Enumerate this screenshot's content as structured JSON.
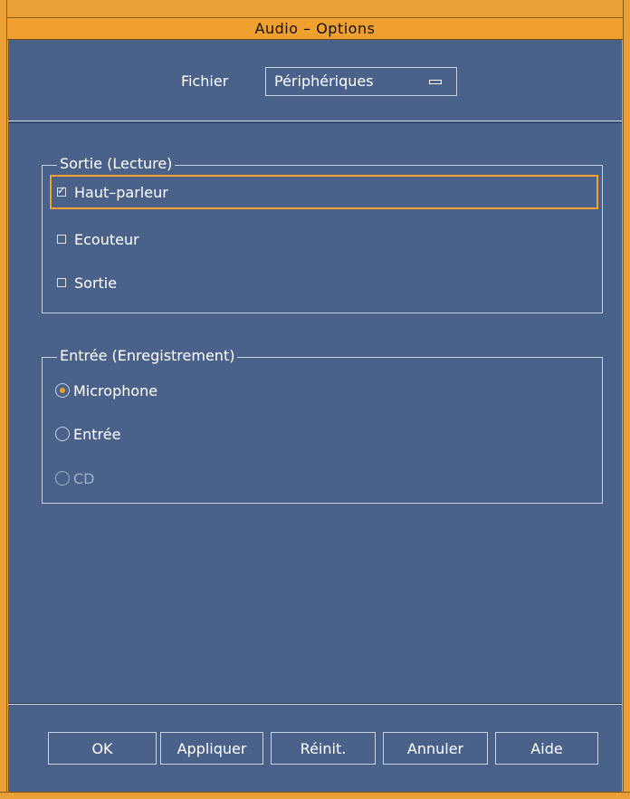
{
  "window": {
    "title": "Audio – Options"
  },
  "header": {
    "fichier_label": "Fichier",
    "category_value": "Périphériques"
  },
  "output_group": {
    "legend": "Sortie (Lecture)",
    "items": [
      {
        "label": "Haut–parleur",
        "checked": true
      },
      {
        "label": "Ecouteur",
        "checked": false
      },
      {
        "label": "Sortie",
        "checked": false
      }
    ]
  },
  "input_group": {
    "legend": "Entrée (Enregistrement)",
    "items": [
      {
        "label": "Microphone",
        "selected": true,
        "enabled": true
      },
      {
        "label": "Entrée",
        "selected": false,
        "enabled": true
      },
      {
        "label": "CD",
        "selected": false,
        "enabled": false
      }
    ]
  },
  "buttons": {
    "ok": "OK",
    "apply": "Appliquer",
    "reset": "Réinit.",
    "cancel": "Annuler",
    "help": "Aide"
  },
  "colors": {
    "background": "#4a6289",
    "accent": "#f0a030"
  }
}
